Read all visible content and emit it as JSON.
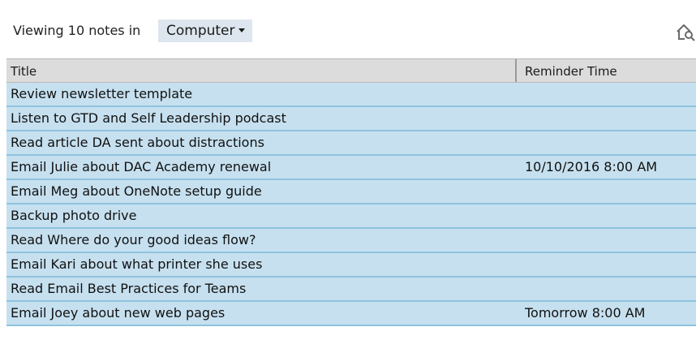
{
  "toolbar": {
    "viewing_label": "Viewing 10 notes in",
    "folder_selected": "Computer",
    "search_icon": "search-icon"
  },
  "table": {
    "columns": [
      "Title",
      "Reminder Time"
    ],
    "rows": [
      {
        "title": "Review newsletter template",
        "reminder": ""
      },
      {
        "title": "Listen to GTD and Self Leadership podcast",
        "reminder": ""
      },
      {
        "title": "Read article DA sent about distractions",
        "reminder": ""
      },
      {
        "title": "Email Julie about DAC Academy renewal",
        "reminder": "10/10/2016 8:00 AM"
      },
      {
        "title": "Email Meg about OneNote setup guide",
        "reminder": ""
      },
      {
        "title": "Backup photo drive",
        "reminder": ""
      },
      {
        "title": "Read Where do your good ideas flow?",
        "reminder": ""
      },
      {
        "title": "Email Kari about what printer she uses",
        "reminder": ""
      },
      {
        "title": "Read Email Best Practices for Teams",
        "reminder": ""
      },
      {
        "title": "Email Joey about new web pages",
        "reminder": "Tomorrow 8:00 AM"
      }
    ]
  },
  "colors": {
    "row_bg": "#c6e0ef",
    "row_separator": "#8fc2df",
    "header_bg": "#dcdcdc",
    "dropdown_bg": "#dde6ee"
  }
}
